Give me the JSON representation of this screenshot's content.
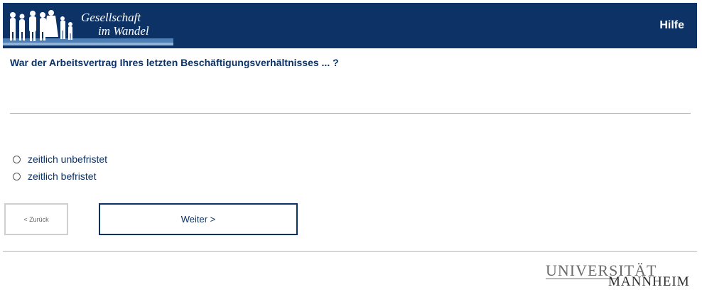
{
  "header": {
    "logo_line1": "Gesellschaft",
    "logo_line2": "im Wandel",
    "help_label": "Hilfe",
    "background_color": "#0c3266"
  },
  "question": {
    "text": "War der Arbeitsvertrag Ihres letzten Beschäftigungsverhältnisses ... ?"
  },
  "options": [
    {
      "label": "zeitlich unbefristet",
      "selected": false
    },
    {
      "label": "zeitlich befristet",
      "selected": false
    }
  ],
  "navigation": {
    "back_label": "< Zurück",
    "next_label": "Weiter >"
  },
  "footer": {
    "university_line1": "UNIVERSITÄT",
    "university_line2": "MANNHEIM"
  },
  "colors": {
    "accent": "#0c3266",
    "rule": "#b3b3b3"
  }
}
